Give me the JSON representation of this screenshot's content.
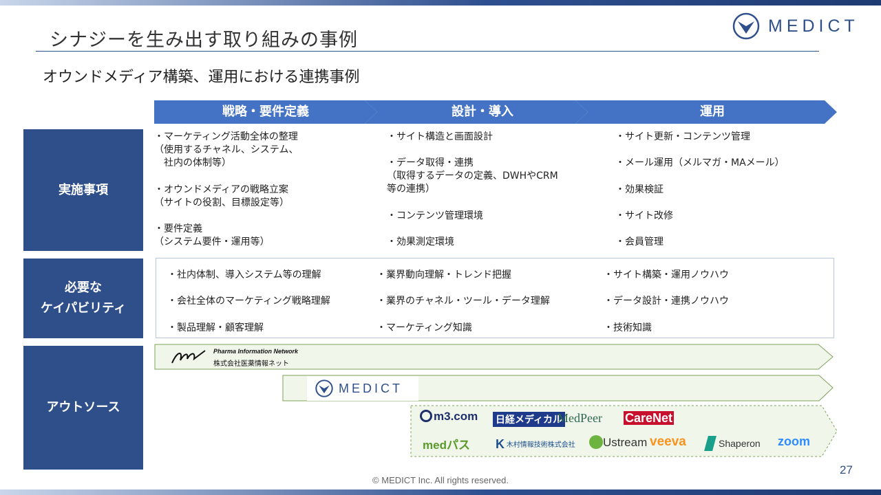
{
  "header": {
    "title": "シナジーを生み出す取り組みの事例",
    "subtitle": "オウンドメディア構築、運用における連携事例",
    "logo_text": "MEDICT"
  },
  "phases": [
    "戦略・要件定義",
    "設計・導入",
    "運用"
  ],
  "rows": {
    "implementation": "実施事項",
    "capability": "必要な\nケイパビリティ",
    "outsource": "アウトソース"
  },
  "implementation": {
    "strategy": [
      "・マーケティング活動全体の整理\n（使用するチャネル、システム、\n　社内の体制等）",
      "・オウンドメディアの戦略立案\n（サイトの役割、目標設定等）",
      "・要件定義\n（システム要件・運用等）"
    ],
    "design": [
      "・サイト構造と画面設計",
      "・データ取得・連携\n（取得するデータの定義、DWHやCRM\n等の連携）",
      "・コンテンツ管理環境",
      "・効果測定環境"
    ],
    "operation": [
      "・サイト更新・コンテンツ管理",
      "・メール運用（メルマガ・MAメール）",
      "・効果検証",
      "・サイト改修",
      "・会員管理"
    ]
  },
  "capabilities": {
    "col1": [
      "・社内体制、導入システム等の理解",
      "・会社全体のマーケティング戦略理解",
      "・製品理解・顧客理解"
    ],
    "col2": [
      "・業界動向理解・トレンド把握",
      "・業界のチャネル・ツール・データ理解",
      "・マーケティング知識"
    ],
    "col3": [
      "・サイト構築・運用ノウハウ",
      "・データ設計・連携ノウハウ",
      "・技術知識"
    ]
  },
  "outsource": {
    "pin_en": "Pharma Information Network",
    "pin_jp": "株式会社医薬情報ネット",
    "medict": "MEDICT",
    "partners_row1": [
      "m3.com",
      "日経メディカル",
      "MedPeer",
      "CareNet"
    ],
    "partners_row2": [
      "medパス",
      "木村情報技術株式会社",
      "Ustream",
      "veeva",
      "Shaperon",
      "zoom"
    ]
  },
  "footer": "© MEDICT Inc.  All rights reserved.",
  "page_number": "27",
  "colors": {
    "navy": "#2f4f8a",
    "chevron": "#4472c4",
    "green_fill": "#f1f6ea",
    "green_line": "#7fa35a"
  }
}
